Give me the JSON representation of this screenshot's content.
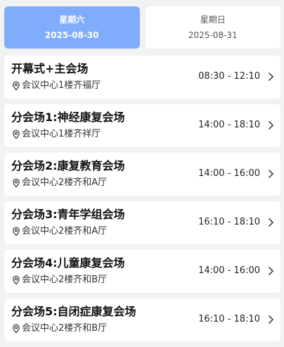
{
  "tabs": [
    {
      "day": "星期六",
      "date": "2025-08-30",
      "active": true
    },
    {
      "day": "星期日",
      "date": "2025-08-31",
      "active": false
    }
  ],
  "sessions": [
    {
      "title": "开幕式+主会场",
      "location": "会议中心1楼齐福厅",
      "time": "08:30 - 12:10"
    },
    {
      "title": "分会场1:神经康复会场",
      "location": "会议中心1楼齐祥厅",
      "time": "14:00 - 18:10"
    },
    {
      "title": "分会场2:康复教育会场",
      "location": "会议中心2楼齐和A厅",
      "time": "14:00 - 16:00"
    },
    {
      "title": "分会场3:青年学组会场",
      "location": "会议中心2楼齐和A厅",
      "time": "16:10 - 18:10"
    },
    {
      "title": "分会场4:儿童康复会场",
      "location": "会议中心2楼齐和B厅",
      "time": "14:00 - 16:00"
    },
    {
      "title": "分会场5:自闭症康复会场",
      "location": "会议中心2楼齐和B厅",
      "time": "16:10 - 18:10"
    }
  ],
  "icons": {
    "location": "location-pin-icon",
    "chevron": "chevron-right-icon"
  },
  "colors": {
    "active_tab": "#7fadfc",
    "background": "#f1f2f4",
    "card": "#ffffff"
  }
}
